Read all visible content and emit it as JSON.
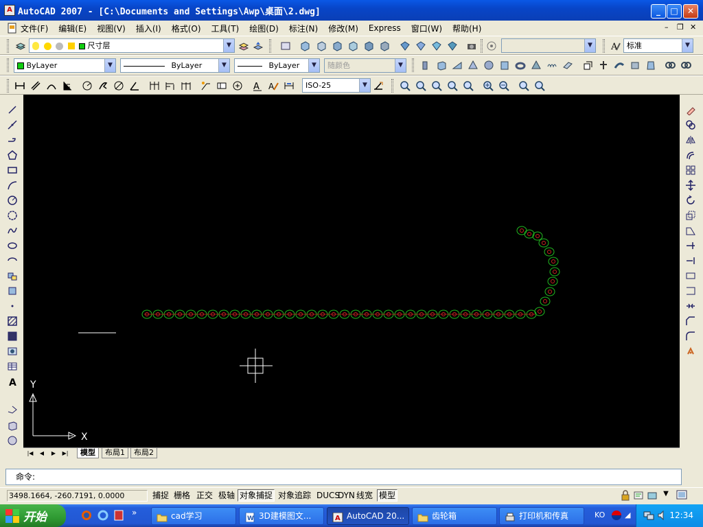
{
  "window": {
    "title": "AutoCAD 2007 - [C:\\Documents and Settings\\Awp\\桌面\\2.dwg]"
  },
  "menu": [
    "文件(F)",
    "编辑(E)",
    "视图(V)",
    "插入(I)",
    "格式(O)",
    "工具(T)",
    "绘图(D)",
    "标注(N)",
    "修改(M)",
    "Express",
    "窗口(W)",
    "帮助(H)"
  ],
  "layers": {
    "current_layer": "尺寸层",
    "text_style": "标准"
  },
  "properties": {
    "color": "ByLayer",
    "linetype": "ByLayer",
    "lineweight": "ByLayer",
    "plot_style": "随颜色"
  },
  "dimension": {
    "style": "ISO-25"
  },
  "ucs": {
    "x_label": "X",
    "y_label": "Y"
  },
  "layout_tabs": [
    "模型",
    "布局1",
    "布局2"
  ],
  "command_line": {
    "prompt": "命令:"
  },
  "status": {
    "coordinates": "3498.1664, -260.7191, 0.0000",
    "toggles": [
      {
        "label": "捕捉",
        "on": false
      },
      {
        "label": "栅格",
        "on": false
      },
      {
        "label": "正交",
        "on": false
      },
      {
        "label": "极轴",
        "on": false
      },
      {
        "label": "对象捕捉",
        "on": true
      },
      {
        "label": "对象追踪",
        "on": false
      },
      {
        "label": "DUCS",
        "on": false
      },
      {
        "label": "DYN",
        "on": false
      },
      {
        "label": "线宽",
        "on": false
      },
      {
        "label": "模型",
        "on": true
      }
    ]
  },
  "taskbar": {
    "start_label": "开始",
    "tasks": [
      {
        "label": "cad学习"
      },
      {
        "label": "3D建模图文..."
      },
      {
        "label": "AutoCAD 20..."
      },
      {
        "label": "齿轮箱"
      },
      {
        "label": "打印机和传真"
      }
    ],
    "ime": "KO",
    "clock": "12:34"
  },
  "colors": {
    "chain_outline": "#22bb22",
    "chain_pins": "#cc2222",
    "canvas": "#000000"
  }
}
